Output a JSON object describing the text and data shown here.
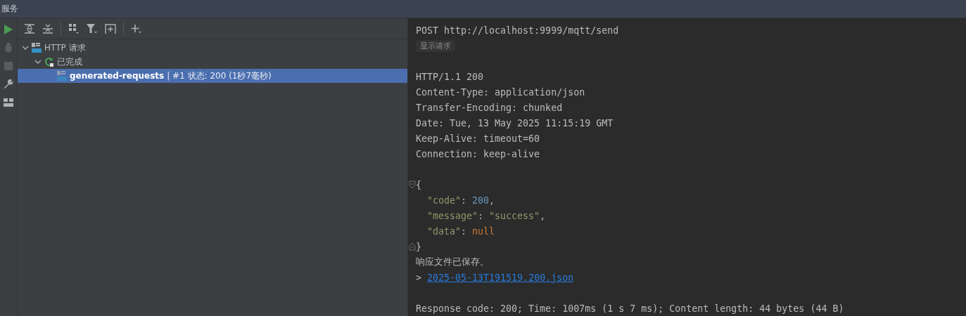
{
  "window": {
    "title": "服务"
  },
  "sidebar": {
    "tools": [
      {
        "kind": "run",
        "disabled": false
      },
      {
        "kind": "debug",
        "disabled": true
      },
      {
        "kind": "stop",
        "disabled": true
      },
      {
        "kind": "settings",
        "disabled": false
      },
      {
        "kind": "layout",
        "disabled": false
      }
    ]
  },
  "toolbar": {
    "buttons": [
      {
        "kind": "expand-all"
      },
      {
        "kind": "collapse-all"
      },
      {
        "kind": "group",
        "separator_before": true
      },
      {
        "kind": "filter"
      },
      {
        "kind": "add-frame"
      },
      {
        "kind": "add",
        "separator_before": true
      }
    ]
  },
  "tree": [
    {
      "kind": "api",
      "label": "HTTP 请求",
      "expanded": true,
      "selected": false,
      "children": [
        {
          "kind": "finished",
          "label": "已完成",
          "expanded": true,
          "selected": false,
          "children": [
            {
              "kind": "request",
              "label": "generated-requests",
              "detail": "|  #1 状态: 200 (1秒7毫秒)",
              "selected": true
            }
          ]
        }
      ]
    }
  ],
  "console": {
    "lines": [
      {
        "kind": "text",
        "text": "POST http://localhost:9999/mqtt/send"
      },
      {
        "kind": "button",
        "text": "显示请求"
      },
      {
        "kind": "blank"
      },
      {
        "kind": "text",
        "text": "HTTP/1.1 200"
      },
      {
        "kind": "text",
        "text": "Content-Type: application/json"
      },
      {
        "kind": "text",
        "text": "Transfer-Encoding: chunked"
      },
      {
        "kind": "text",
        "text": "Date: Tue, 13 May 2025 11:15:19 GMT"
      },
      {
        "kind": "text",
        "text": "Keep-Alive: timeout=60"
      },
      {
        "kind": "text",
        "text": "Connection: keep-alive"
      },
      {
        "kind": "blank"
      },
      {
        "kind": "json",
        "open": "{",
        "close": "}",
        "members": [
          {
            "tokens": [
              {
                "kind": "key",
                "text": "\"code\""
              },
              {
                "kind": "punct",
                "text": ": "
              },
              {
                "kind": "number",
                "text": "200"
              },
              {
                "kind": "punct",
                "text": ","
              }
            ]
          },
          {
            "tokens": [
              {
                "kind": "key",
                "text": "\"message\""
              },
              {
                "kind": "punct",
                "text": ": "
              },
              {
                "kind": "string",
                "text": "\"success\""
              },
              {
                "kind": "punct",
                "text": ","
              }
            ]
          },
          {
            "tokens": [
              {
                "kind": "key",
                "text": "\"data\""
              },
              {
                "kind": "punct",
                "text": ": "
              },
              {
                "kind": "keyword",
                "text": "null"
              }
            ]
          }
        ]
      },
      {
        "kind": "text",
        "text": "响应文件已保存。"
      },
      {
        "kind": "link",
        "prefix": ">",
        "text": "2025-05-13T191519.200.json"
      },
      {
        "kind": "blank"
      },
      {
        "kind": "text",
        "text": "Response code: 200; Time: 1007ms (1 s 7 ms); Content length: 44 bytes (44 B)"
      }
    ]
  }
}
